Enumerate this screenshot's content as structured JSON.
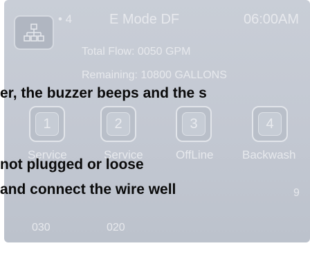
{
  "status_bar": {
    "count": "• 4",
    "mode": "E Mode DF",
    "time": "06:00AM"
  },
  "info": {
    "total_flow": "Total Flow:  0050 GPM",
    "remaining": "Remaining: 10800 GALLONS"
  },
  "valves": [
    {
      "number": "1",
      "label": "Service",
      "value": "030"
    },
    {
      "number": "2",
      "label": "Service",
      "value": "020"
    },
    {
      "number": "3",
      "label": "OffLine",
      "value": ""
    },
    {
      "number": "4",
      "label": "Backwash",
      "value": "9"
    }
  ],
  "overlay": {
    "line1": "er, the buzzer beeps and the s",
    "line2": "not plugged or loose",
    "line3": "and connect the wire well"
  },
  "colors": {
    "panel": "#c5cad4",
    "ghost_text": "#e7e9ed",
    "overlay_text": "#0a0a0a"
  },
  "icons": {
    "tree_button": "network-tree-icon"
  }
}
